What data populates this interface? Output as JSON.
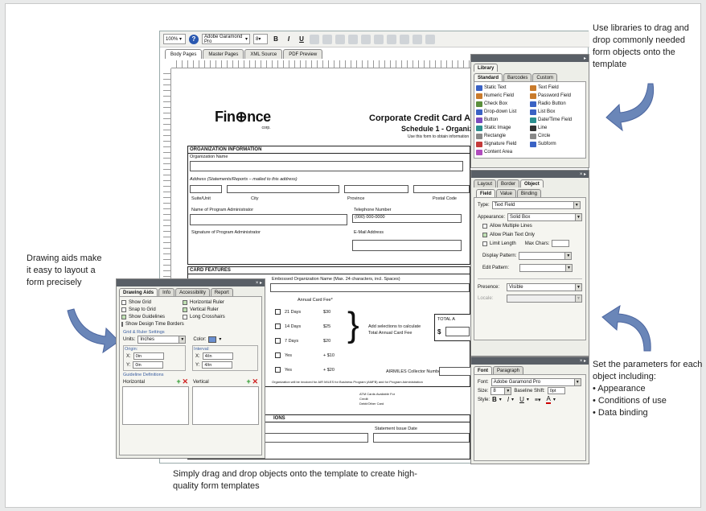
{
  "notes": {
    "libraries": "Use libraries to drag and drop commonly needed form objects onto the template",
    "drawing_aids": "Drawing aids make it easy to layout a form precisely",
    "parameters_intro": "Set the parameters for each object including:",
    "parameters_items": [
      "• Appearance",
      "• Conditions of use",
      "• Data binding"
    ],
    "drag_drop": "Simply drag and drop objects onto the template to create high-quality form templates"
  },
  "toolbar": {
    "zoom": "100%",
    "font": "Adobe Garamond Pro",
    "size": "8",
    "bold": "B",
    "italic": "I",
    "underline": "U"
  },
  "doc_tabs": [
    "Body Pages",
    "Master Pages",
    "XML Source",
    "PDF Preview"
  ],
  "form": {
    "logo": "Fin⊕nce",
    "logo_corp": "corp.",
    "title": "Corporate Credit Card Acc",
    "subtitle": "Schedule 1 - Organiz",
    "instruction": "Use this form to obtain information",
    "org_header": "ORGANIZATION INFORMATION",
    "org_name": "Organization Name",
    "address": "Address (Statements/Reports – mailed to this address)",
    "suite": "Suite/Unit",
    "city": "City",
    "province": "Province",
    "postal": "Postal Code",
    "admin": "Name of Program Administrator",
    "phone": "Telephone Number",
    "phone_value": "(000) 000-0000",
    "signature": "Signature of Program Administrator",
    "email": "E-Mail Address",
    "card_header": "CARD FEATURES",
    "embossed": "Embossed Organization Name (Max. 24 characters, incl. Spaces)",
    "fee_label": "Annual Card Fee*",
    "fees": [
      {
        "label": "21 Days",
        "amount": "$30"
      },
      {
        "label": "14 Days",
        "amount": "$25"
      },
      {
        "label": "7 Days",
        "amount": "$20"
      },
      {
        "label": "Yes",
        "amount": "+ $10"
      },
      {
        "label": "Yes",
        "amount": "+ $20"
      }
    ],
    "calc_note": "Add selections to calculate Total Annual Card Fee",
    "total": "TOTAL A",
    "dollar": "$",
    "airmiles": "AIRMILES Collector Number:",
    "disclaimer": "Organization will be invoiced for AIR MILES for Business Program (AMFB) and for Program Administration",
    "small1": "ATM Cards Available For",
    "small2": "Credit",
    "small3": "Debit/Other Card",
    "section3": "IONS",
    "statement": "Statement Issue Date"
  },
  "library": {
    "title": "Library",
    "tabs": [
      "Standard",
      "Barcodes",
      "Custom"
    ],
    "items_left": [
      "Static Text",
      "Numeric Field",
      "Check Box",
      "Drop-down List",
      "Button",
      "Static Image",
      "Rectangle",
      "Signature Field",
      "Content Area"
    ],
    "items_right": [
      "Text Field",
      "Password Field",
      "Radio Button",
      "List Box",
      "Date/Time Field",
      "Line",
      "Circle",
      "Subform"
    ],
    "colors_left": [
      "#3a62c4",
      "#c97b2c",
      "#5a8f3c",
      "#3a62c4",
      "#7a4bbd",
      "#2a8f8f",
      "#888888",
      "#c43a3a",
      "#b04bbd"
    ],
    "colors_right": [
      "#c97b2c",
      "#c97b2c",
      "#3a62c4",
      "#3a62c4",
      "#2a8f8f",
      "#333333",
      "#888888",
      "#3a62c4"
    ]
  },
  "object_panel": {
    "tabs": [
      "Layout",
      "Border",
      "Object"
    ],
    "subtabs": [
      "Field",
      "Value",
      "Binding"
    ],
    "type_label": "Type:",
    "type_value": "Text Field",
    "appearance_label": "Appearance:",
    "appearance_value": "Solid Box",
    "allow_multiple": "Allow Multiple Lines",
    "allow_plain": "Allow Plain Text Only",
    "limit_length": "Limit Length",
    "max_chars": "Max Chars:",
    "display_pattern": "Display Pattern:",
    "edit_pattern": "Edit Pattern:",
    "presence_label": "Presence:",
    "presence_value": "Visible",
    "locale_label": "Locale:"
  },
  "font_panel": {
    "tabs": [
      "Font",
      "Paragraph"
    ],
    "font_label": "Font:",
    "font_value": "Adobe Garamond Pro",
    "size_label": "Size:",
    "size_value": "8",
    "baseline_label": "Baseline Shift:",
    "baseline_value": "0pt",
    "style_label": "Style:",
    "style_b": "B",
    "style_i": "I",
    "style_u": "U",
    "style_a": "A"
  },
  "drawing_panel": {
    "tabs": [
      "Drawing Aids",
      "Info",
      "Accessibility",
      "Report"
    ],
    "left": [
      "Show Grid",
      "Snap to Grid",
      "Show Guidelines",
      "Show Design Time Borders"
    ],
    "left_checked": [
      false,
      false,
      true,
      false
    ],
    "right": [
      "Horizontal Ruler",
      "Vertical Ruler",
      "Long Crosshairs"
    ],
    "right_checked": [
      true,
      true,
      false
    ],
    "grid_settings": "Grid & Ruler Settings",
    "units_label": "Units:",
    "units_value": "Inches",
    "color_label": "Color:",
    "origin_label": "Origin:",
    "interval_label": "Interval:",
    "origin_x": "0in",
    "origin_y": "0in",
    "interval_x": "4/in",
    "interval_y": "4/in",
    "x": "X:",
    "y": "Y:",
    "guideline_defs": "Guideline Definitions",
    "horizontal": "Horizontal",
    "vertical": "Vertical"
  }
}
